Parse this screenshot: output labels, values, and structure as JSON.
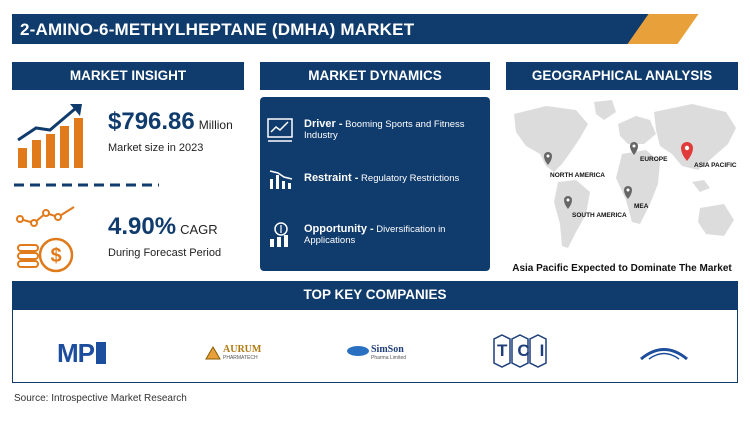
{
  "title": "2-AMINO-6-METHYLHEPTANE (DMHA) MARKET",
  "sections": {
    "insight": "MARKET INSIGHT",
    "dynamics": "MARKET DYNAMICS",
    "geo": "GEOGRAPHICAL ANALYSIS",
    "companies": "TOP KEY COMPANIES"
  },
  "insight": {
    "market_size_value": "$796.86",
    "market_size_unit": "Million",
    "market_size_label": "Market size in 2023",
    "cagr_value": "4.90%",
    "cagr_unit": "CAGR",
    "cagr_label": "During Forecast Period"
  },
  "dynamics": {
    "driver_label": "Driver -",
    "driver_text": "Booming Sports and Fitness Industry",
    "restraint_label": "Restraint -",
    "restraint_text": "Regulatory Restrictions",
    "opportunity_label": "Opportunity -",
    "opportunity_text": "Diversification in Applications"
  },
  "geo": {
    "regions": [
      "NORTH AMERICA",
      "EUROPE",
      "ASIA PACIFIC",
      "MEA",
      "SOUTH AMERICA"
    ],
    "caption": "Asia Pacific Expected to Dominate The Market"
  },
  "companies": {
    "logo1": "MP",
    "logo2": "AURUM",
    "logo2_sub": "PHARMATECH",
    "logo3": "SimSon",
    "logo3_sub": "Pharma Limited",
    "logo4": "TCI"
  },
  "source": "Source: Introspective Market Research",
  "colors": {
    "navy": "#0f3b6d",
    "orange": "#e07a1a",
    "gold": "#e8a13a",
    "pin_red": "#e03a3a"
  }
}
